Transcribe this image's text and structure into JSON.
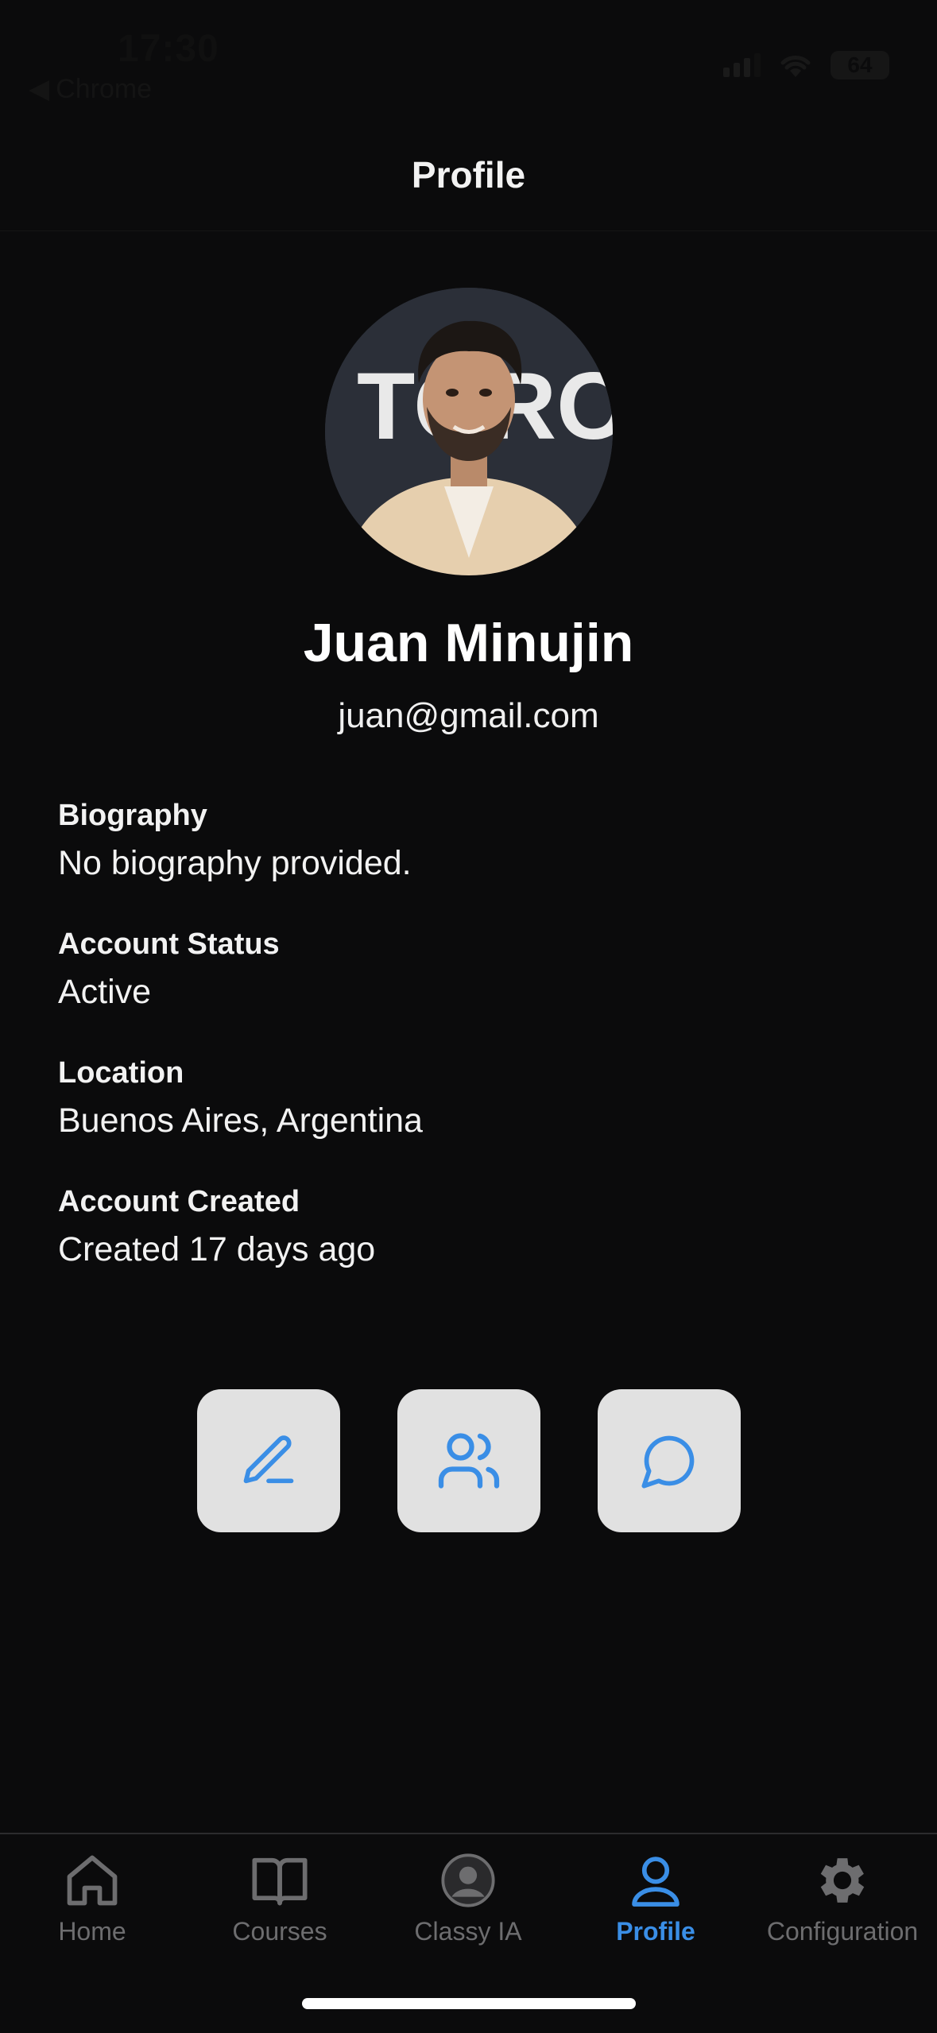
{
  "status_bar": {
    "time": "17:30",
    "back_app": "Chrome",
    "battery": "64"
  },
  "header": {
    "title": "Profile"
  },
  "profile": {
    "name": "Juan Minujin",
    "email": "juan@gmail.com",
    "avatar_backdrop_text": "TORO",
    "fields": [
      {
        "label": "Biography",
        "value": "No biography provided."
      },
      {
        "label": "Account Status",
        "value": "Active"
      },
      {
        "label": "Location",
        "value": "Buenos Aires, Argentina"
      },
      {
        "label": "Account Created",
        "value": "Created 17 days ago"
      }
    ]
  },
  "actions": [
    {
      "icon": "edit-icon"
    },
    {
      "icon": "users-icon"
    },
    {
      "icon": "chat-icon"
    }
  ],
  "tabbar": {
    "tabs": [
      {
        "label": "Home",
        "icon": "home-icon"
      },
      {
        "label": "Courses",
        "icon": "book-icon"
      },
      {
        "label": "Classy IA",
        "icon": "assistant-avatar-icon"
      },
      {
        "label": "Profile",
        "icon": "user-icon",
        "active": true
      },
      {
        "label": "Configuration",
        "icon": "gear-icon"
      }
    ]
  },
  "colors": {
    "background": "#0b0b0c",
    "accent": "#3a8ee6",
    "button_bg": "#e1e1e1",
    "inactive_tab": "#6d6d6f"
  }
}
